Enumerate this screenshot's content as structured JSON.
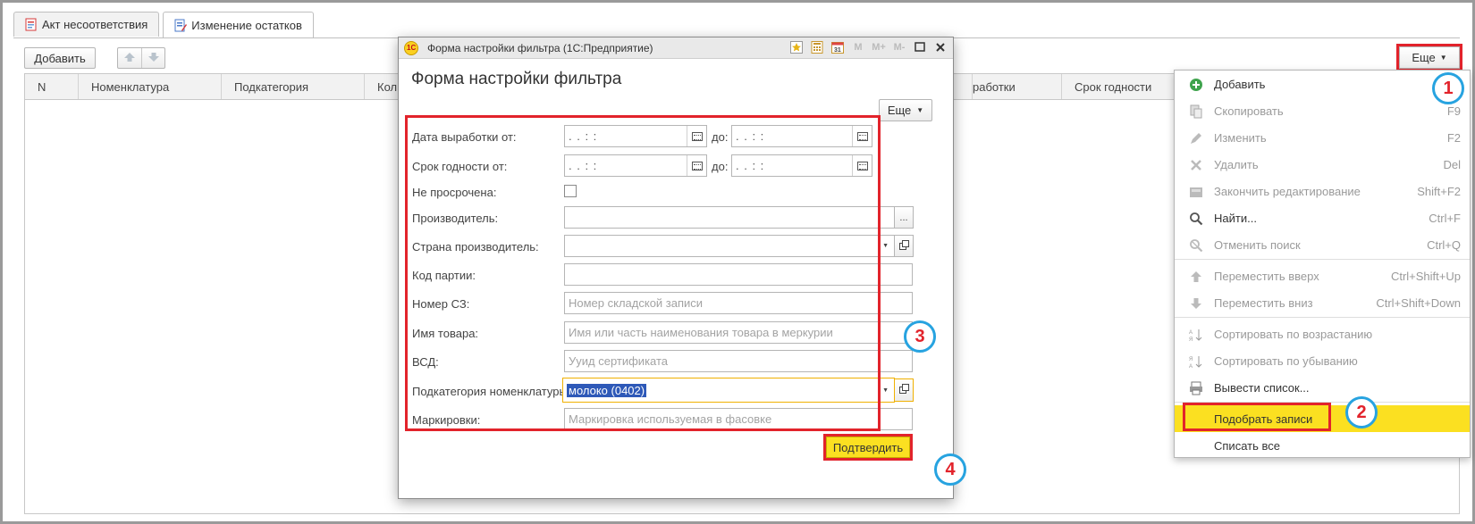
{
  "tabs": [
    {
      "label": "Акт несоответствия",
      "active": false
    },
    {
      "label": "Изменение остатков",
      "active": true
    }
  ],
  "toolbar": {
    "add_label": "Добавить",
    "more_label": "Еще"
  },
  "grid": {
    "columns": [
      "N",
      "Номенклатура",
      "Подкатегория",
      "Кол",
      "работки",
      "Срок годности"
    ]
  },
  "menu": {
    "items": [
      {
        "label": "Добавить",
        "shortcut": "",
        "enabled": true,
        "icon": "plus-circle-icon"
      },
      {
        "label": "Скопировать",
        "shortcut": "F9",
        "enabled": false,
        "icon": "copy-icon"
      },
      {
        "label": "Изменить",
        "shortcut": "F2",
        "enabled": false,
        "icon": "pencil-icon"
      },
      {
        "label": "Удалить",
        "shortcut": "Del",
        "enabled": false,
        "icon": "delete-x-icon"
      },
      {
        "label": "Закончить редактирование",
        "shortcut": "Shift+F2",
        "enabled": false,
        "icon": "finish-edit-icon"
      },
      {
        "label": "Найти...",
        "shortcut": "Ctrl+F",
        "enabled": true,
        "icon": "search-icon"
      },
      {
        "label": "Отменить поиск",
        "shortcut": "Ctrl+Q",
        "enabled": false,
        "icon": "cancel-search-icon"
      },
      {
        "label": "Переместить вверх",
        "shortcut": "Ctrl+Shift+Up",
        "enabled": false,
        "icon": "arrow-up-icon"
      },
      {
        "label": "Переместить вниз",
        "shortcut": "Ctrl+Shift+Down",
        "enabled": false,
        "icon": "arrow-down-icon"
      },
      {
        "label": "Сортировать по возрастанию",
        "shortcut": "",
        "enabled": false,
        "icon": "sort-asc-icon"
      },
      {
        "label": "Сортировать по убыванию",
        "shortcut": "",
        "enabled": false,
        "icon": "sort-desc-icon"
      },
      {
        "label": "Вывести список...",
        "shortcut": "",
        "enabled": true,
        "icon": "print-list-icon"
      },
      {
        "label": "Подобрать записи",
        "shortcut": "",
        "enabled": true,
        "icon": ""
      },
      {
        "label": "Списать все",
        "shortcut": "",
        "enabled": true,
        "icon": ""
      }
    ]
  },
  "dialog": {
    "window_title": "Форма настройки фильтра  (1С:Предприятие)",
    "logo_text": "1С",
    "title": "Форма настройки фильтра",
    "more_label": "Еще",
    "titlebar_buttons": [
      "М",
      "М+",
      "М-"
    ],
    "fields": {
      "production_from_label": "Дата выработки от:",
      "expiry_from_label": "Срок годности от:",
      "to_label": "до:",
      "date_mask": " .  .       :  :",
      "not_expired_label": "Не просрочена:",
      "manufacturer_label": "Производитель:",
      "country_label": "Страна производитель:",
      "batch_code_label": "Код партии:",
      "sz_number_label": "Номер СЗ:",
      "sz_number_placeholder": "Номер складской записи",
      "product_name_label": "Имя товара:",
      "product_name_placeholder": "Имя или часть наименования товара в меркурии",
      "vsd_label": "ВСД:",
      "vsd_placeholder": "Ууид сертификата",
      "subcategory_label": "Подкатегория номенклатуры:",
      "subcategory_value": "молоко (0402)",
      "marking_label": "Маркировки:",
      "marking_placeholder": "Маркировка используемая в фасовке"
    },
    "confirm_label": "Подтвердить"
  },
  "badges": [
    "1",
    "2",
    "3",
    "4"
  ],
  "colors": {
    "highlight_red": "#e2232b",
    "badge_blue": "#27a3e0",
    "accent_yellow": "#fbe021"
  }
}
